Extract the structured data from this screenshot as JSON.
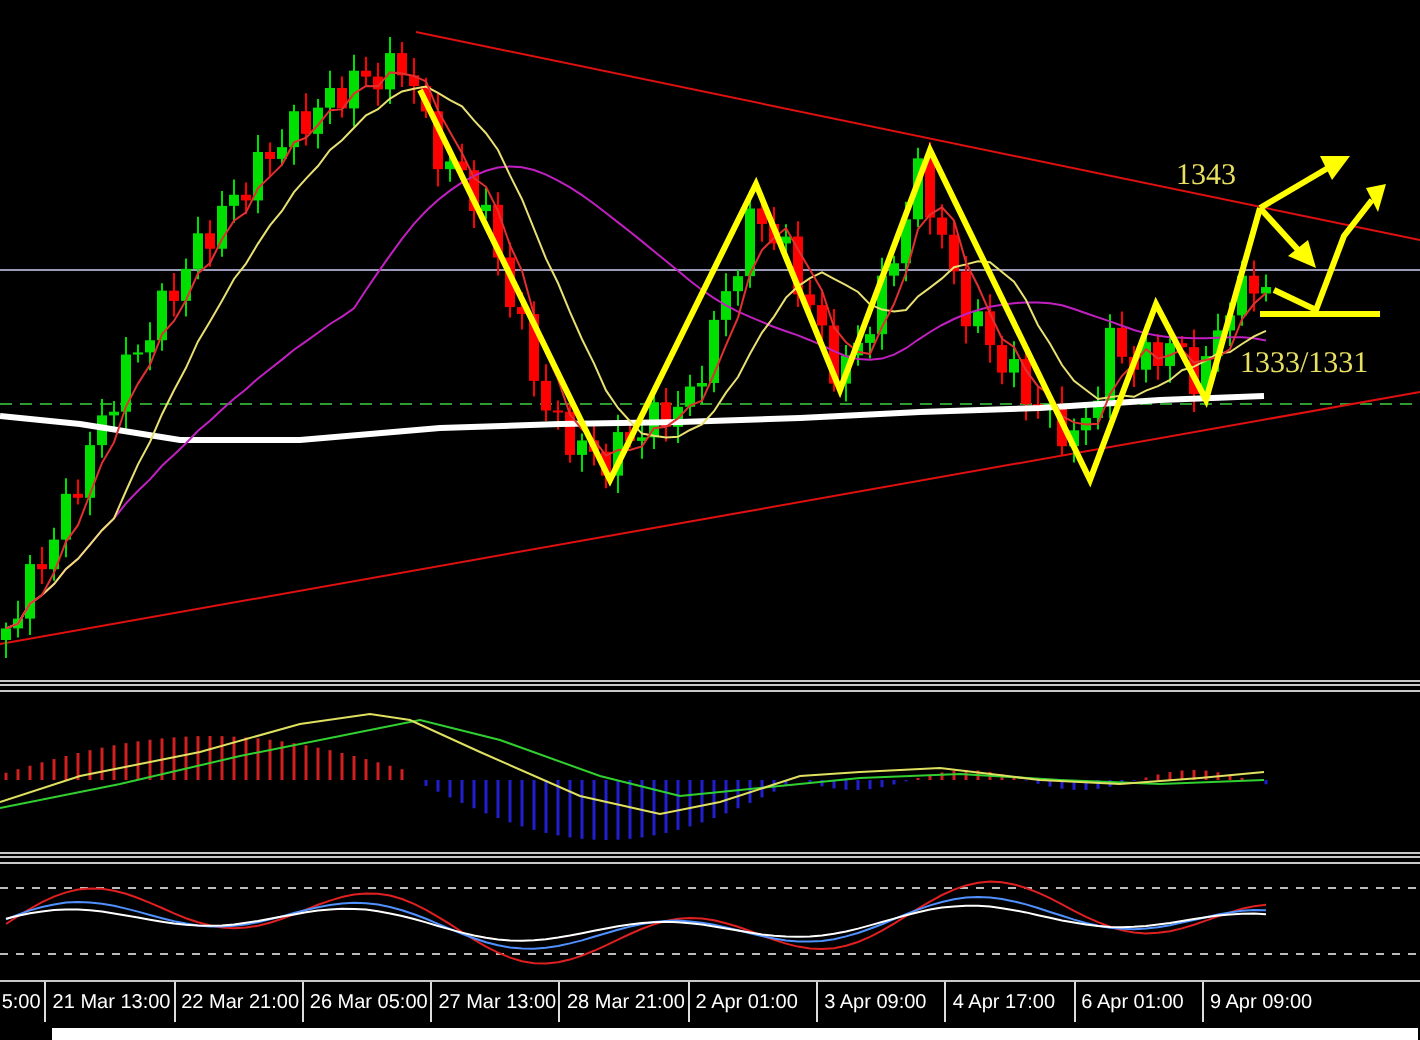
{
  "main_chart": {
    "annotations": [
      "1343",
      "1333/1331"
    ]
  },
  "time_axis": {
    "labels": [
      "5:00",
      "21 Mar 13:00",
      "22 Mar 21:00",
      "26 Mar 05:00",
      "27 Mar 13:00",
      "28 Mar 21:00",
      "2 Apr 01:00",
      "3 Apr 09:00",
      "4 Apr 17:00",
      "6 Apr 01:00",
      "9 Apr 09:00"
    ]
  }
}
